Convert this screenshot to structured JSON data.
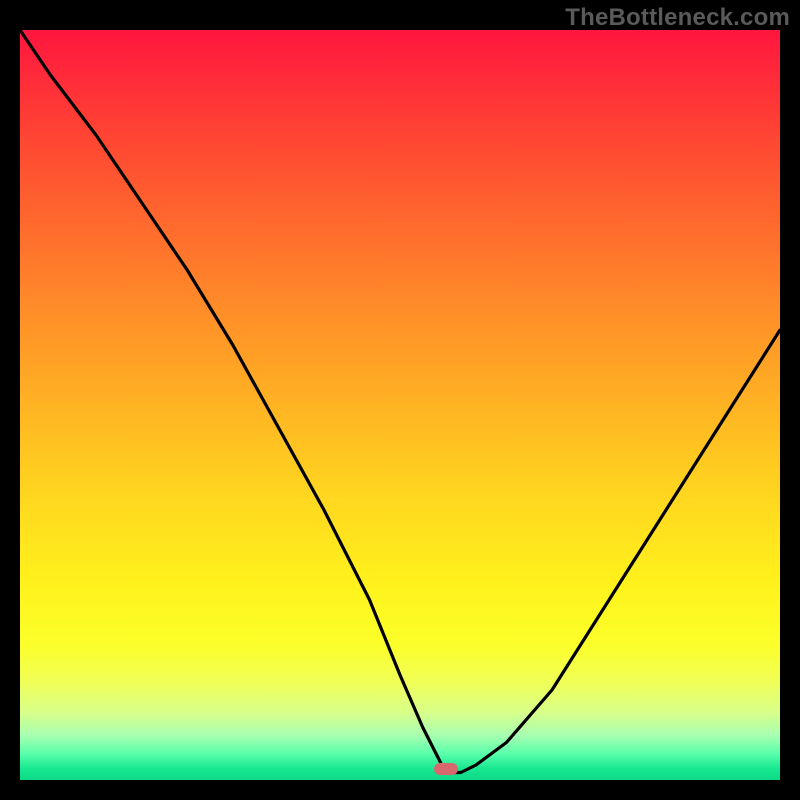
{
  "watermark": "TheBottleneck.com",
  "chart_data": {
    "type": "line",
    "title": "",
    "xlabel": "",
    "ylabel": "",
    "xlim": [
      0,
      100
    ],
    "ylim": [
      0,
      100
    ],
    "grid": false,
    "legend": false,
    "marker": {
      "x": 56,
      "y": 1.5,
      "color": "#d6686e"
    },
    "background_gradient_stops": [
      {
        "pct": 0,
        "color": "#ff163e"
      },
      {
        "pct": 50,
        "color": "#ffb323"
      },
      {
        "pct": 80,
        "color": "#fbff2a"
      },
      {
        "pct": 100,
        "color": "#0ed989"
      }
    ],
    "series": [
      {
        "name": "bottleneck-curve",
        "x": [
          0,
          4,
          10,
          16,
          22,
          28,
          34,
          40,
          46,
          50,
          53,
          55,
          56,
          58,
          60,
          64,
          70,
          80,
          90,
          100
        ],
        "values": [
          100,
          94,
          86,
          77,
          68,
          58,
          47,
          36,
          24,
          14,
          7,
          3,
          1,
          1,
          2,
          5,
          12,
          28,
          44,
          60
        ]
      }
    ]
  }
}
